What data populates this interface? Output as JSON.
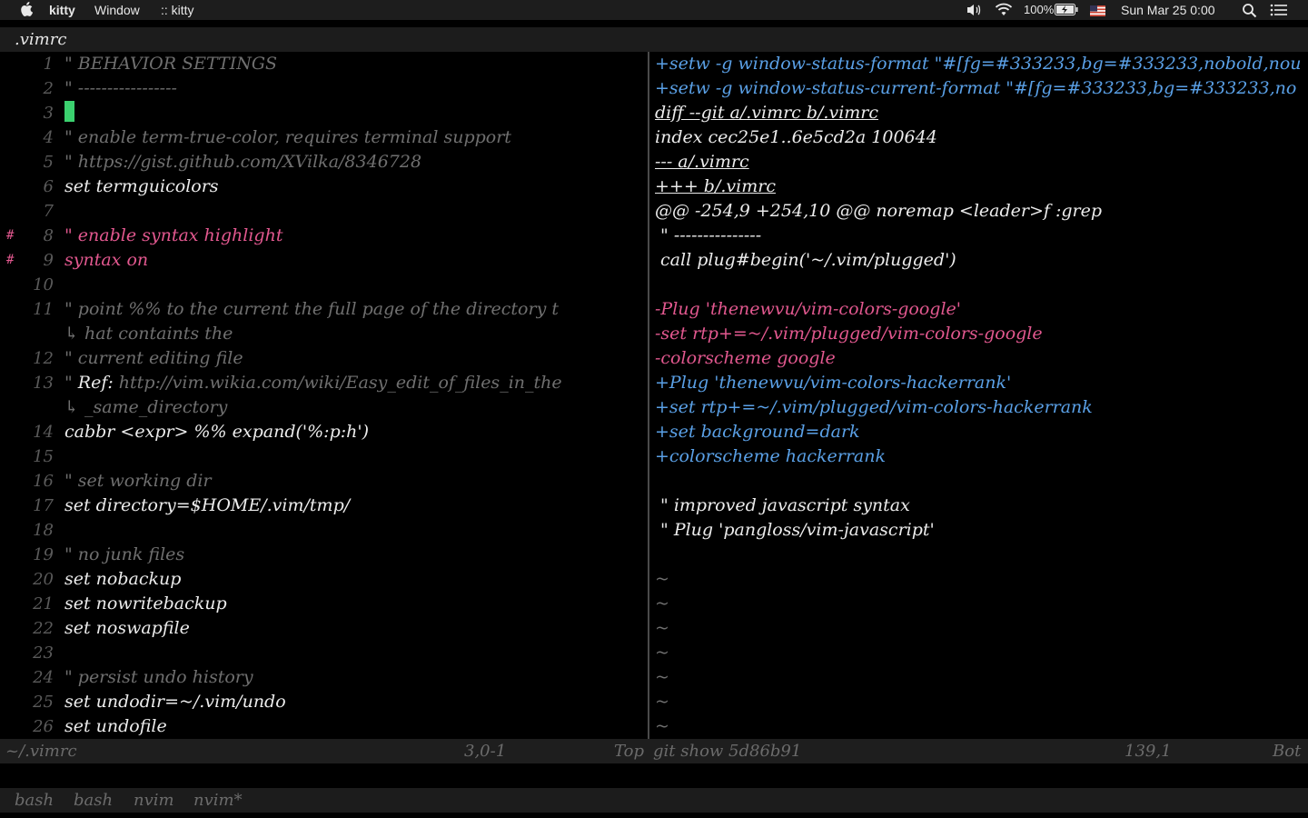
{
  "colors": {
    "menubar_bg": "#1d1d1d",
    "comment": "#6f6f6f",
    "text": "#ececec",
    "pink": "#e2588f",
    "blue": "#5aa0e6",
    "linenumber": "#5a5a5a",
    "cursor": "#3bd16f",
    "divider": "#4a4a4a"
  },
  "menubar": {
    "apple_icon": "apple-icon",
    "app_name": "kitty",
    "window_menu": "Window",
    "title": ":: kitty",
    "battery": "100%",
    "datetime": "Sun Mar 25  0:00",
    "icons": [
      "volume-icon",
      "wifi-icon",
      "battery-icon",
      "flag-icon",
      "search-icon",
      "list-icon"
    ]
  },
  "tab_title": ".vimrc",
  "left_lines": [
    {
      "num": "1",
      "text": "\" BEHAVIOR SETTINGS",
      "style": "comment",
      "sign": ""
    },
    {
      "num": "2",
      "text": "\" -----------------",
      "style": "comment",
      "sign": ""
    },
    {
      "num": "3",
      "text": "",
      "style": "text",
      "sign": "",
      "cursor": true
    },
    {
      "num": "4",
      "text": "\" enable term-true-color, requires terminal support",
      "style": "comment",
      "sign": ""
    },
    {
      "num": "5",
      "text": "\" https://gist.github.com/XVilka/8346728",
      "style": "comment",
      "sign": ""
    },
    {
      "num": "6",
      "text": "set termguicolors",
      "style": "text",
      "sign": ""
    },
    {
      "num": "7",
      "text": "",
      "style": "text",
      "sign": ""
    },
    {
      "num": "8",
      "text": "\" enable syntax highlight",
      "style": "pink",
      "sign": "#"
    },
    {
      "num": "9",
      "text": "syntax on",
      "style": "pink",
      "sign": "#"
    },
    {
      "num": "10",
      "text": "",
      "style": "text",
      "sign": ""
    },
    {
      "num": "11",
      "text": "\" point %% to the current the full page of the directory t",
      "style": "comment",
      "sign": ""
    },
    {
      "num": "",
      "text": "↳ hat containts the",
      "style": "comment",
      "sign": ""
    },
    {
      "num": "12",
      "text": "\" current editing file",
      "style": "comment",
      "sign": ""
    },
    {
      "num": "13",
      "text": "\" Ref: http://vim.wikia.com/wiki/Easy_edit_of_files_in_the",
      "style": "comment",
      "sign": "",
      "ref": true
    },
    {
      "num": "",
      "text": "↳ _same_directory",
      "style": "comment",
      "sign": ""
    },
    {
      "num": "14",
      "text": "cabbr <expr> %% expand('%:p:h')",
      "style": "text",
      "sign": ""
    },
    {
      "num": "15",
      "text": "",
      "style": "text",
      "sign": ""
    },
    {
      "num": "16",
      "text": "\" set working dir",
      "style": "comment",
      "sign": ""
    },
    {
      "num": "17",
      "text": "set directory=$HOME/.vim/tmp/",
      "style": "text",
      "sign": ""
    },
    {
      "num": "18",
      "text": "",
      "style": "text",
      "sign": ""
    },
    {
      "num": "19",
      "text": "\" no junk files",
      "style": "comment",
      "sign": ""
    },
    {
      "num": "20",
      "text": "set nobackup",
      "style": "text",
      "sign": ""
    },
    {
      "num": "21",
      "text": "set nowritebackup",
      "style": "text",
      "sign": ""
    },
    {
      "num": "22",
      "text": "set noswapfile",
      "style": "text",
      "sign": ""
    },
    {
      "num": "23",
      "text": "",
      "style": "text",
      "sign": ""
    },
    {
      "num": "24",
      "text": "\" persist undo history",
      "style": "comment",
      "sign": ""
    },
    {
      "num": "25",
      "text": "set undodir=~/.vim/undo",
      "style": "text",
      "sign": ""
    },
    {
      "num": "26",
      "text": "set undofile",
      "style": "text",
      "sign": ""
    }
  ],
  "right_lines": [
    {
      "text": "+setw -g window-status-format \"#[fg=#333233,bg=#333233,nobold,nou",
      "style": "blue"
    },
    {
      "text": "+setw -g window-status-current-format \"#[fg=#333233,bg=#333233,no",
      "style": "blue"
    },
    {
      "text": "diff --git a/.vimrc b/.vimrc",
      "style": "text",
      "underline": true
    },
    {
      "text": "index cec25e1..6e5cd2a 100644",
      "style": "text"
    },
    {
      "text": "--- a/.vimrc",
      "style": "text",
      "underline": true
    },
    {
      "text": "+++ b/.vimrc",
      "style": "text",
      "underline": true
    },
    {
      "text": "@@ -254,9 +254,10 @@ noremap <leader>f :grep",
      "style": "text"
    },
    {
      "text": " \" ---------------",
      "style": "text"
    },
    {
      "text": " call plug#begin('~/.vim/plugged')",
      "style": "text"
    },
    {
      "text": "",
      "style": "text"
    },
    {
      "text": "-Plug 'thenewvu/vim-colors-google'",
      "style": "pink"
    },
    {
      "text": "-set rtp+=~/.vim/plugged/vim-colors-google",
      "style": "pink"
    },
    {
      "text": "-colorscheme google",
      "style": "pink"
    },
    {
      "text": "+Plug 'thenewvu/vim-colors-hackerrank'",
      "style": "blue"
    },
    {
      "text": "+set rtp+=~/.vim/plugged/vim-colors-hackerrank",
      "style": "blue"
    },
    {
      "text": "+set background=dark",
      "style": "blue"
    },
    {
      "text": "+colorscheme hackerrank",
      "style": "blue"
    },
    {
      "text": "",
      "style": "text"
    },
    {
      "text": " \" improved javascript syntax",
      "style": "text"
    },
    {
      "text": " \" Plug 'pangloss/vim-javascript'",
      "style": "text"
    },
    {
      "text": "",
      "style": "text"
    },
    {
      "text": "~",
      "style": "comment"
    },
    {
      "text": "~",
      "style": "comment"
    },
    {
      "text": "~",
      "style": "comment"
    },
    {
      "text": "~",
      "style": "comment"
    },
    {
      "text": "~",
      "style": "comment"
    },
    {
      "text": "~",
      "style": "comment"
    },
    {
      "text": "~",
      "style": "comment"
    }
  ],
  "status": {
    "file": "~/.vimrc",
    "pos": "3,0-1",
    "scroll": "Top",
    "right_title": "git show 5d86b91",
    "right_pos": "139,1",
    "right_scroll": "Bot"
  },
  "tmux_tabs": [
    "bash",
    "bash",
    "nvim",
    "nvim*"
  ]
}
